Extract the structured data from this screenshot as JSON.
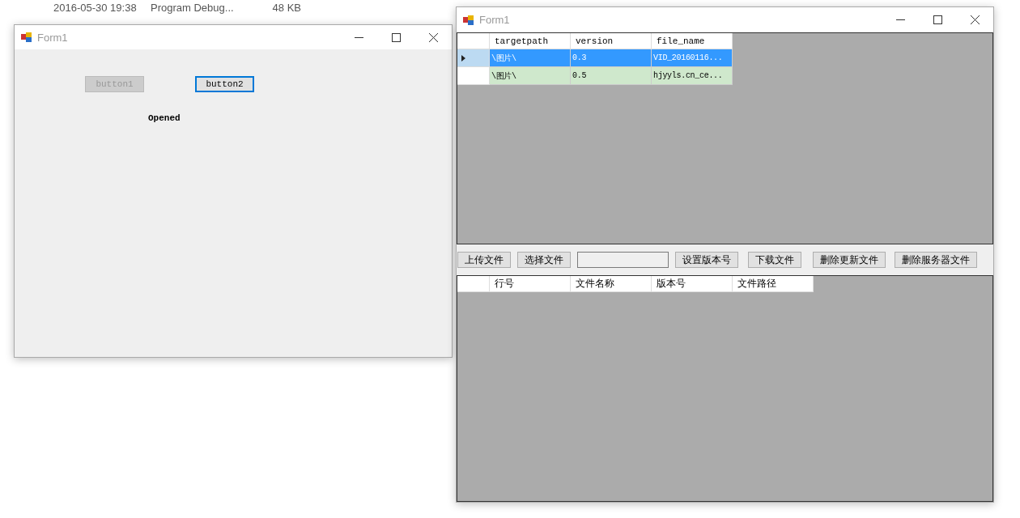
{
  "background_list": {
    "rows": [
      {
        "date": "2016-05-30 19:38",
        "type": "Program Debug...",
        "size": "48 KB"
      }
    ]
  },
  "left_window": {
    "title": "Form1",
    "buttons": [
      {
        "label": "button1",
        "disabled": true,
        "focused": false
      },
      {
        "label": "button2",
        "disabled": false,
        "focused": true
      }
    ],
    "status_label": "Opened"
  },
  "right_window": {
    "title": "Form1",
    "top_grid": {
      "columns": [
        "targetpath",
        "version",
        "file_name"
      ],
      "rows": [
        {
          "selected": true,
          "cells": [
            "\\图片\\",
            "0.3",
            "VID_20160116..."
          ]
        },
        {
          "selected": false,
          "cells": [
            "\\图片\\",
            "0.5",
            "hjyyls.cn_ce..."
          ]
        }
      ]
    },
    "toolbar": [
      {
        "kind": "button",
        "label": "上传文件"
      },
      {
        "kind": "button",
        "label": "选择文件"
      },
      {
        "kind": "field"
      },
      {
        "kind": "button",
        "label": "设置版本号"
      },
      {
        "kind": "button",
        "label": "下载文件"
      },
      {
        "kind": "button",
        "label": "删除更新文件"
      },
      {
        "kind": "button",
        "label": "删除服务器文件"
      }
    ],
    "bottom_grid": {
      "columns": [
        "行号",
        "文件名称",
        "版本号",
        "文件路径"
      ]
    }
  }
}
